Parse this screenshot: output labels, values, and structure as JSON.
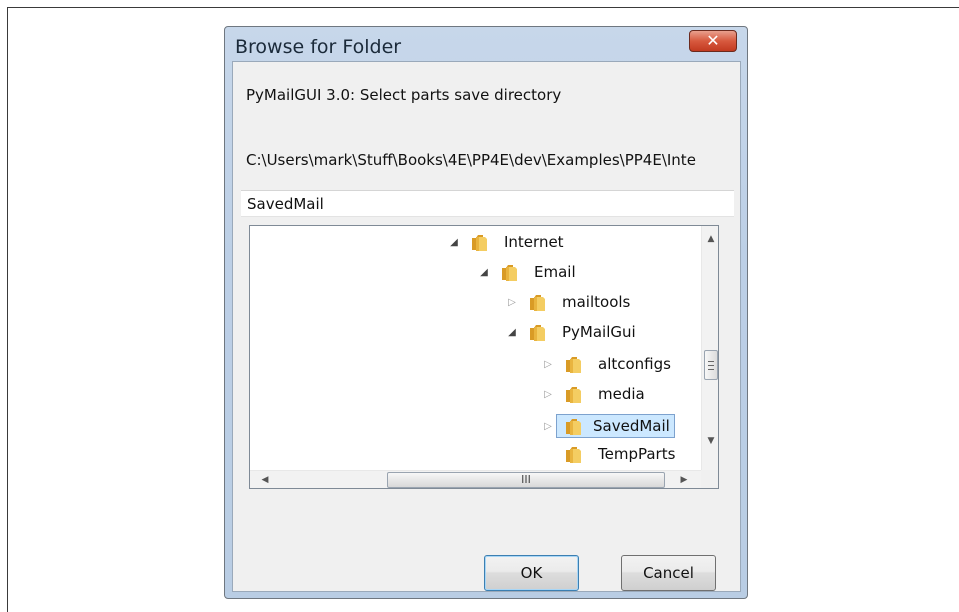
{
  "dialog": {
    "title": "Browse for Folder",
    "close_label": "✕",
    "caption": "PyMailGUI 3.0: Select parts save directory",
    "path": "C:\\Users\\mark\\Stuff\\Books\\4E\\PP4E\\dev\\Examples\\PP4E\\Inte",
    "folder_value": "SavedMail",
    "ok_label": "OK",
    "cancel_label": "Cancel"
  },
  "tree": {
    "items": [
      {
        "label": "Internet",
        "expanded": true
      },
      {
        "label": "Email",
        "expanded": true
      },
      {
        "label": "mailtools",
        "expanded": false
      },
      {
        "label": "PyMailGui",
        "expanded": true
      },
      {
        "label": "altconfigs",
        "expanded": false
      },
      {
        "label": "media",
        "expanded": false
      },
      {
        "label": "SavedMail",
        "expanded": false,
        "selected": true
      },
      {
        "label": "TempParts",
        "expanded": false
      }
    ],
    "hscroll_grip": "III"
  },
  "icons": {
    "folder": "folder-icon",
    "expanded": "triangle-down-icon",
    "collapsed": "triangle-right-icon"
  },
  "colors": {
    "titlebar": "#bccfe6",
    "selection": "#cce8ff",
    "close_button": "#c8452b",
    "folder": "#e8b84a"
  }
}
